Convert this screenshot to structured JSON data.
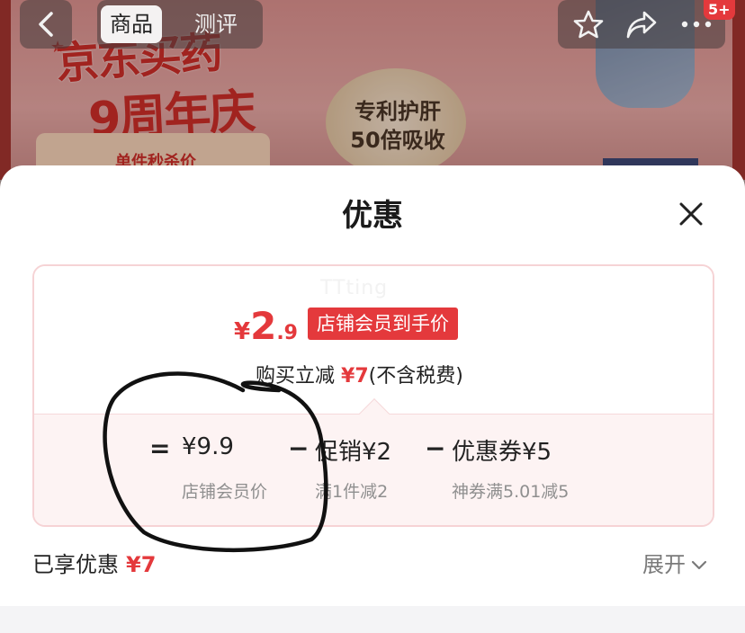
{
  "background": {
    "banner_title": "京东买药",
    "banner_subtitle": "9周年庆",
    "seal_text": "专利护肝 50倍吸收",
    "price_tag_text": "单件秒杀价"
  },
  "nav": {
    "tabs": [
      {
        "label": "商品",
        "active": true
      },
      {
        "label": "测评",
        "active": false
      }
    ],
    "badge": "5+",
    "icons": [
      "back-icon",
      "star-icon",
      "share-icon",
      "more-icon"
    ]
  },
  "sheet": {
    "title": "优惠",
    "watermark": "TTting",
    "final_price": {
      "currency": "¥",
      "integer": "2",
      "decimal": ".9"
    },
    "member_tag": "店铺会员到手价",
    "reduce_prefix": "购买立减",
    "reduce_amount": "¥7",
    "reduce_suffix": "(不含税费)",
    "breakdown": [
      {
        "op": "=",
        "value": "¥9.9",
        "label": "店铺会员价"
      },
      {
        "op": "−",
        "value": "促销¥2",
        "label": "满1件减2"
      },
      {
        "op": "−",
        "value": "优惠券¥5",
        "label": "神券满5.01减5"
      }
    ],
    "enjoyed_label": "已享优惠",
    "enjoyed_amount": "¥7",
    "expand_label": "展开"
  },
  "colors": {
    "accent_red": "#e4393c",
    "card_border": "#f6d3d5",
    "card_bottom_bg": "#fdf3f3"
  }
}
